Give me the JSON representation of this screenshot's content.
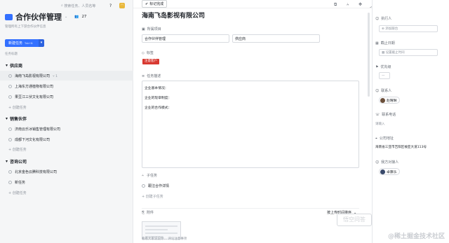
{
  "left": {
    "search_placeholder": "搜索任务、人员名等",
    "help": "?",
    "title": "合作伙伴管理",
    "member_count": "27",
    "subtitle": "管理所有上下游合作伙伴信息",
    "new_task": "新建任务",
    "new_task_kbd": "Tab+N",
    "col_header": "任务标题",
    "groups": [
      {
        "name": "供应商",
        "items": [
          "海南飞岛影视有限公司",
          "上海东方通植物有限公司",
          "果豆江三伏文化有限公司"
        ],
        "add": "+ 创建任务"
      },
      {
        "name": "销售伙伴",
        "items": [
          "济南云乐冰销售管理有限公司",
          "成都下河文化有限公司"
        ],
        "add": "+ 创建任务"
      },
      {
        "name": "咨询公司",
        "items": [
          "北京金色云腾科技有限公司",
          "新任务"
        ],
        "add": "+ 创建任务"
      }
    ],
    "hl_count": "1"
  },
  "toolbar": {
    "mark_done": "标记完成"
  },
  "main": {
    "title": "海南飞岛影视有限公司",
    "project_label": "所属项目",
    "project_value": "合作伙伴管理",
    "section_value": "供应商",
    "tags_label": "标签",
    "tag": "注意客户",
    "desc_label": "任务描述",
    "desc_lines": [
      "企业基本情况：",
      "企业的现章制度：",
      "企业的合作模式："
    ],
    "subtasks_label": "子任务",
    "subtask_item": "跟注合作详情",
    "add_subtask": "+ 创建子任务",
    "attach_label": "附件",
    "attach_sort": "按上传时间排序",
    "comment_placeholder": "看看大家说说你…    评论注意事项"
  },
  "right": {
    "assignee_label": "执行人",
    "assignee_placeholder": "添加跟台",
    "due_label": "截止日期",
    "due_placeholder": "设置截止时间",
    "priority_label": "优先级",
    "contact_label": "联系人",
    "contact_name": "赵晴琳",
    "phone_label": "联系电话",
    "phone_placeholder": "请输入",
    "address_label": "公司地址",
    "address_value": "海南省三亚市吉阳区榆亚大道113号",
    "partner_label": "我方对接人",
    "partner_name": "卓康乐"
  },
  "watermark": "@稀土掘金技术社区",
  "watermark2": "悟空问答",
  "colors": {
    "accent": "#3370ff",
    "tag": "#d83931"
  }
}
